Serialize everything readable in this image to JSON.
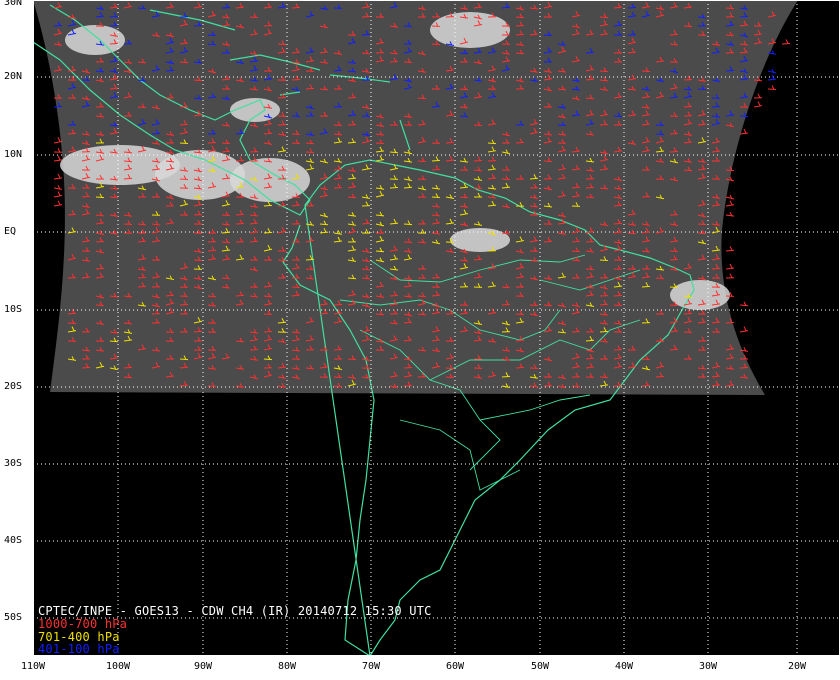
{
  "map": {
    "title": "CPTEC/INPE - GOES13 - CDW CH4 (IR) 20140712 15:30 UTC",
    "legend": [
      {
        "label": "1000-700 hPa",
        "color": "#ff3030"
      },
      {
        "label": "701-400 hPa",
        "color": "#f0e000"
      },
      {
        "label": "401-100 hPa",
        "color": "#1020ff"
      }
    ],
    "lat_labels": [
      "30N",
      "20N",
      "10N",
      "EQ",
      "10S",
      "20S",
      "30S",
      "40S",
      "50S"
    ],
    "lon_labels": [
      "110W",
      "100W",
      "90W",
      "80W",
      "70W",
      "60W",
      "50W",
      "40W",
      "30W",
      "20W"
    ],
    "colors": {
      "background": "#000000",
      "coastline": "#40e0a0",
      "grid": "#ffffff",
      "frame": "#ffffff",
      "satellite_gray": "#4a4a4a"
    }
  }
}
